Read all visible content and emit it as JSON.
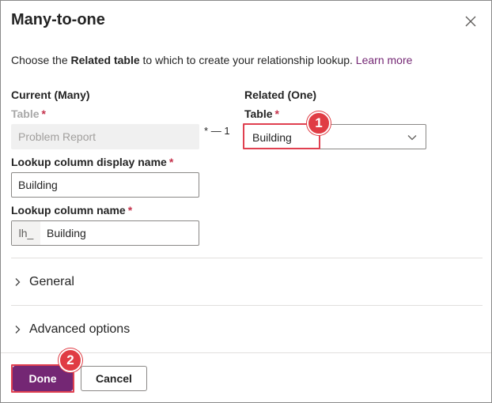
{
  "dialog": {
    "title": "Many-to-one",
    "intro_prefix": "Choose the ",
    "intro_bold": "Related table",
    "intro_suffix": " to which to create your relationship lookup.",
    "learn_more": "Learn more"
  },
  "current": {
    "heading": "Current (Many)",
    "table_label": "Table",
    "table_value": "Problem Report",
    "display_name_label": "Lookup column display name",
    "display_name_value": "Building",
    "column_name_label": "Lookup column name",
    "column_name_prefix": "lh_",
    "column_name_value": "Building"
  },
  "connector": {
    "many": "*",
    "dash": "—",
    "one": "1"
  },
  "related": {
    "heading": "Related (One)",
    "table_label": "Table",
    "table_value": "Building"
  },
  "required_mark": "*",
  "callouts": {
    "first": "1",
    "second": "2"
  },
  "sections": {
    "general": "General",
    "advanced": "Advanced options"
  },
  "footer": {
    "done": "Done",
    "cancel": "Cancel"
  },
  "colors": {
    "accent": "#742774",
    "highlight": "#e04050",
    "required": "#c4314b"
  },
  "icons": {
    "close": "close-icon",
    "dropdown": "chevron-down-icon",
    "expand": "chevron-right-icon"
  }
}
